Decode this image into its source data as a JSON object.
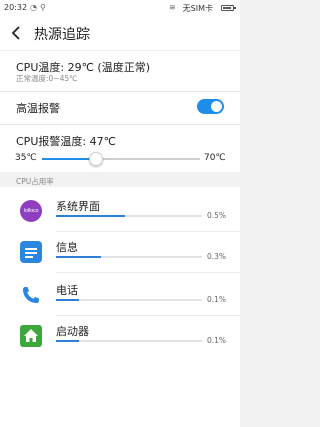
{
  "status_bar": {
    "time": "20:32",
    "carrier": "无SIM卡"
  },
  "app_bar": {
    "title": "热源追踪"
  },
  "cpu": {
    "temperature_text": "CPU温度: 29℃ (温度正常)",
    "normal_range_text": "正常温度:0~45℃"
  },
  "alarm": {
    "label": "高温报警",
    "enabled": true,
    "threshold_text": "CPU报警温度: 47℃",
    "slider_min_label": "35℃",
    "slider_max_label": "70℃",
    "slider_value": 47,
    "slider_min": 35,
    "slider_max": 70
  },
  "usage": {
    "section_title": "CPU占用率",
    "apps": [
      {
        "name": "系统界面",
        "percent_text": "0.5%",
        "bar_fraction": 0.47,
        "icon": "system-ui-icon",
        "icon_text": "lolloco"
      },
      {
        "name": "信息",
        "percent_text": "0.3%",
        "bar_fraction": 0.31,
        "icon": "message-icon"
      },
      {
        "name": "电话",
        "percent_text": "0.1%",
        "bar_fraction": 0.16,
        "icon": "phone-icon"
      },
      {
        "name": "启动器",
        "percent_text": "0.1%",
        "bar_fraction": 0.16,
        "icon": "launcher-icon"
      }
    ]
  },
  "colors": {
    "accent": "#1f8ee8",
    "usage_bar": "#2f7fd6",
    "system_ui_icon": "#8e3fbf",
    "message_icon": "#2a86e0",
    "phone_icon": "#2a86e0",
    "launcher_icon": "#3da63d"
  }
}
